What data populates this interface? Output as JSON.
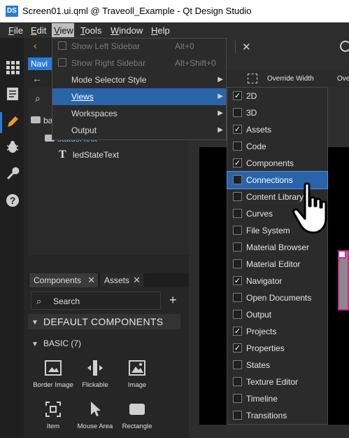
{
  "window": {
    "title": "Screen01.ui.qml @ Traveoll_Example - Qt Design Studio",
    "app_icon_text": "DS"
  },
  "menubar": [
    {
      "label": "File",
      "accel": "F",
      "rest": "ile"
    },
    {
      "label": "Edit",
      "accel": "E",
      "rest": "dit"
    },
    {
      "label": "View",
      "accel": "V",
      "rest": "iew"
    },
    {
      "label": "Tools",
      "accel": "T",
      "rest": "ools"
    },
    {
      "label": "Window",
      "accel": "W",
      "rest": "indow"
    },
    {
      "label": "Help",
      "accel": "H",
      "rest": "elp"
    }
  ],
  "view_menu": [
    {
      "label": "Show Left Sidebar",
      "shortcut": "Alt+0",
      "disabled": true,
      "has_check": true
    },
    {
      "label": "Show Right Sidebar",
      "shortcut": "Alt+Shift+0",
      "disabled": true,
      "has_check": true
    },
    {
      "label": "Mode Selector Style",
      "submenu": true
    },
    {
      "label": "Views",
      "submenu": true,
      "highlighted": true
    },
    {
      "label": "Workspaces",
      "submenu": true
    },
    {
      "label": "Output",
      "submenu": true
    }
  ],
  "views_submenu": [
    {
      "label": "2D",
      "checked": true
    },
    {
      "label": "3D",
      "checked": false
    },
    {
      "label": "Assets",
      "checked": true
    },
    {
      "label": "Code",
      "checked": false
    },
    {
      "label": "Components",
      "checked": true
    },
    {
      "label": "Connections",
      "checked": false,
      "highlighted": true
    },
    {
      "label": "Content Library",
      "checked": false
    },
    {
      "label": "Curves",
      "checked": false
    },
    {
      "label": "File System",
      "checked": false
    },
    {
      "label": "Material Browser",
      "checked": false
    },
    {
      "label": "Material Editor",
      "checked": false
    },
    {
      "label": "Navigator",
      "checked": true
    },
    {
      "label": "Open Documents",
      "checked": false
    },
    {
      "label": "Output",
      "checked": false
    },
    {
      "label": "Projects",
      "checked": true
    },
    {
      "label": "Properties",
      "checked": true
    },
    {
      "label": "States",
      "checked": false
    },
    {
      "label": "Texture Editor",
      "checked": false
    },
    {
      "label": "Timeline",
      "checked": false
    },
    {
      "label": "Transitions",
      "checked": false
    }
  ],
  "navigator": {
    "tab_label": "Navi",
    "tree": [
      {
        "label": "ba"
      },
      {
        "label": "statusRect"
      },
      {
        "label": "ledStateText"
      }
    ]
  },
  "toolbar_right": {
    "override_label": "Override Width",
    "override_label2": "Ove"
  },
  "components_panel": {
    "tabs": [
      "Components",
      "Assets"
    ],
    "search_placeholder": "Search",
    "section_title": "DEFAULT COMPONENTS",
    "group_title": "BASIC (7)",
    "items": [
      "Border Image",
      "Flickable",
      "Image",
      "Item",
      "Mouse Area",
      "Rectangle"
    ]
  },
  "colors": {
    "accent": "#2a7bd4",
    "highlight": "#2a64a8",
    "selection": "#c8298f"
  }
}
